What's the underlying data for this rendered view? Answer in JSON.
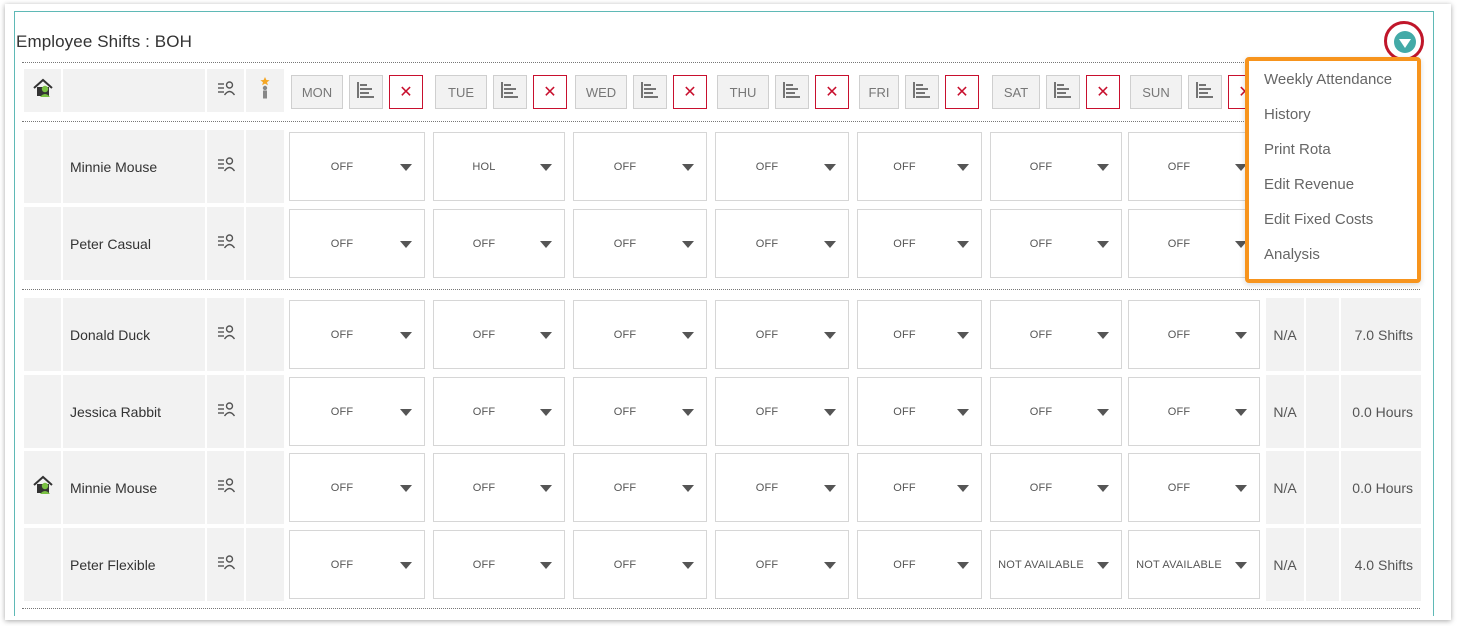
{
  "panel": {
    "title": "Employee Shifts : BOH"
  },
  "icons": {
    "header_employee_icon": "employee-home-icon",
    "header_profile_icon": "user-list-icon",
    "header_skills_icon": "person-star-icon",
    "align_icon": "align-left-icon",
    "remove_icon": "close-icon",
    "toggle_icon": "triangle-down-icon"
  },
  "days": [
    {
      "label": "MON",
      "remove": "✕"
    },
    {
      "label": "TUE",
      "remove": "✕"
    },
    {
      "label": "WED",
      "remove": "✕"
    },
    {
      "label": "THU",
      "remove": "✕"
    },
    {
      "label": "FRI",
      "remove": "✕"
    },
    {
      "label": "SAT",
      "remove": "✕"
    },
    {
      "label": "SUN",
      "remove": "✕"
    }
  ],
  "groups": [
    {
      "rows": [
        {
          "name": "Minnie Mouse",
          "home_icon": false,
          "shifts": [
            "OFF",
            "HOL",
            "OFF",
            "OFF",
            "OFF",
            "OFF",
            "OFF"
          ]
        },
        {
          "name": "Peter Casual",
          "home_icon": false,
          "shifts": [
            "OFF",
            "OFF",
            "OFF",
            "OFF",
            "OFF",
            "OFF",
            "OFF"
          ]
        }
      ]
    },
    {
      "rows": [
        {
          "name": "Donald Duck",
          "home_icon": false,
          "shifts": [
            "OFF",
            "OFF",
            "OFF",
            "OFF",
            "OFF",
            "OFF",
            "OFF"
          ],
          "availability": "N/A",
          "total": "7.0 Shifts"
        },
        {
          "name": "Jessica Rabbit",
          "home_icon": false,
          "shifts": [
            "OFF",
            "OFF",
            "OFF",
            "OFF",
            "OFF",
            "OFF",
            "OFF"
          ],
          "availability": "N/A",
          "total": "0.0 Hours"
        },
        {
          "name": "Minnie Mouse",
          "home_icon": true,
          "shifts": [
            "OFF",
            "OFF",
            "OFF",
            "OFF",
            "OFF",
            "OFF",
            "OFF"
          ],
          "availability": "N/A",
          "total": "0.0 Hours"
        },
        {
          "name": "Peter Flexible",
          "home_icon": false,
          "shifts": [
            "OFF",
            "OFF",
            "OFF",
            "OFF",
            "OFF",
            "NOT AVAILABLE",
            "NOT AVAILABLE"
          ],
          "availability": "N/A",
          "total": "4.0 Shifts"
        }
      ]
    }
  ],
  "menu": {
    "items": [
      "Weekly Attendance",
      "History",
      "Print Rota",
      "Edit Revenue",
      "Edit Fixed Costs",
      "Analysis"
    ]
  },
  "colors": {
    "panel_border": "#5fb9b6",
    "toggle": "#43aaa7",
    "highlight_ring": "#c0162a",
    "menu_highlight": "#f7941d",
    "remove": "#c8102e"
  }
}
